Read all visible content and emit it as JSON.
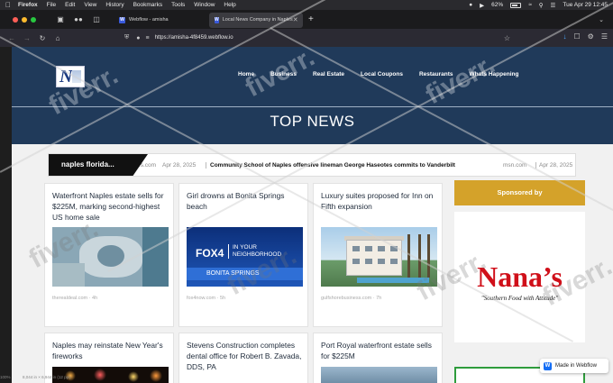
{
  "menubar": {
    "app": "Firefox",
    "items": [
      "File",
      "Edit",
      "View",
      "History",
      "Bookmarks",
      "Tools",
      "Window",
      "Help"
    ],
    "battery": "62%",
    "datetime": "Tue Apr 29  12:45"
  },
  "tabs": [
    {
      "title": "Webflow - amisha",
      "favicon": "W",
      "active": false
    },
    {
      "title": "Local News Company in Naples",
      "favicon": "W",
      "active": true
    }
  ],
  "addressbar": {
    "url": "https://amisha-4f8459.webflow.io"
  },
  "site": {
    "logo_letter": "N",
    "nav": [
      "Home",
      "Business",
      "Real Estate",
      "Local Coupons",
      "Restaurants",
      "Whats Happening"
    ],
    "hero_title": "TOP NEWS"
  },
  "ticker": {
    "label": "naples florida...",
    "source1": "ws.com",
    "date1": "Apr 28, 2025",
    "headline": "Community School of Naples offensive lineman George Haseotes commits to Vanderbilt",
    "source2": "msn.com",
    "date2": "Apr 28, 2025"
  },
  "cards": [
    {
      "title": "Waterfront Naples estate sells for $225M, marking second-highest US home sale",
      "source": "therealdeal.com",
      "age": "4h",
      "image": "aerial-estate"
    },
    {
      "title": "Girl drowns at Bonita Springs beach",
      "source": "fox4now.com",
      "age": "5h",
      "image": "fox4-bonita-springs"
    },
    {
      "title": "Luxury suites proposed for Inn on Fifth expansion",
      "source": "gulfshorebusiness.com",
      "age": "7h",
      "image": "luxury-building"
    },
    {
      "title": "Naples may reinstate New Year's fireworks",
      "source": "",
      "age": "",
      "image": "fireworks"
    },
    {
      "title": "Stevens Construction completes dental office for Robert B. Zavada, DDS, PA",
      "source": "",
      "age": "",
      "image": ""
    },
    {
      "title": "Port Royal waterfront estate sells for $225M",
      "source": "",
      "age": "",
      "image": "waterfront"
    }
  ],
  "fox_image": {
    "brand": "FOX4",
    "sub1": "IN YOUR",
    "sub2": "NEIGHBORHOOD",
    "bar": "BONITA SPRINGS"
  },
  "sponsor": {
    "heading": "Sponsored by",
    "name": "Nana’s",
    "tagline": "\"Southern Food with Attitude\""
  },
  "badge": {
    "label": "Made in Webflow"
  },
  "statusbar": {
    "zoom": "100%",
    "size": "8,044 in × 6,944 in (12 ppi)"
  },
  "watermark": "fiverr.",
  "colors": {
    "hero": "#203a5a",
    "sponsor_gold": "#d4a22a",
    "nanas_red": "#d0101a",
    "firefox_bg": "#2b2a33"
  }
}
